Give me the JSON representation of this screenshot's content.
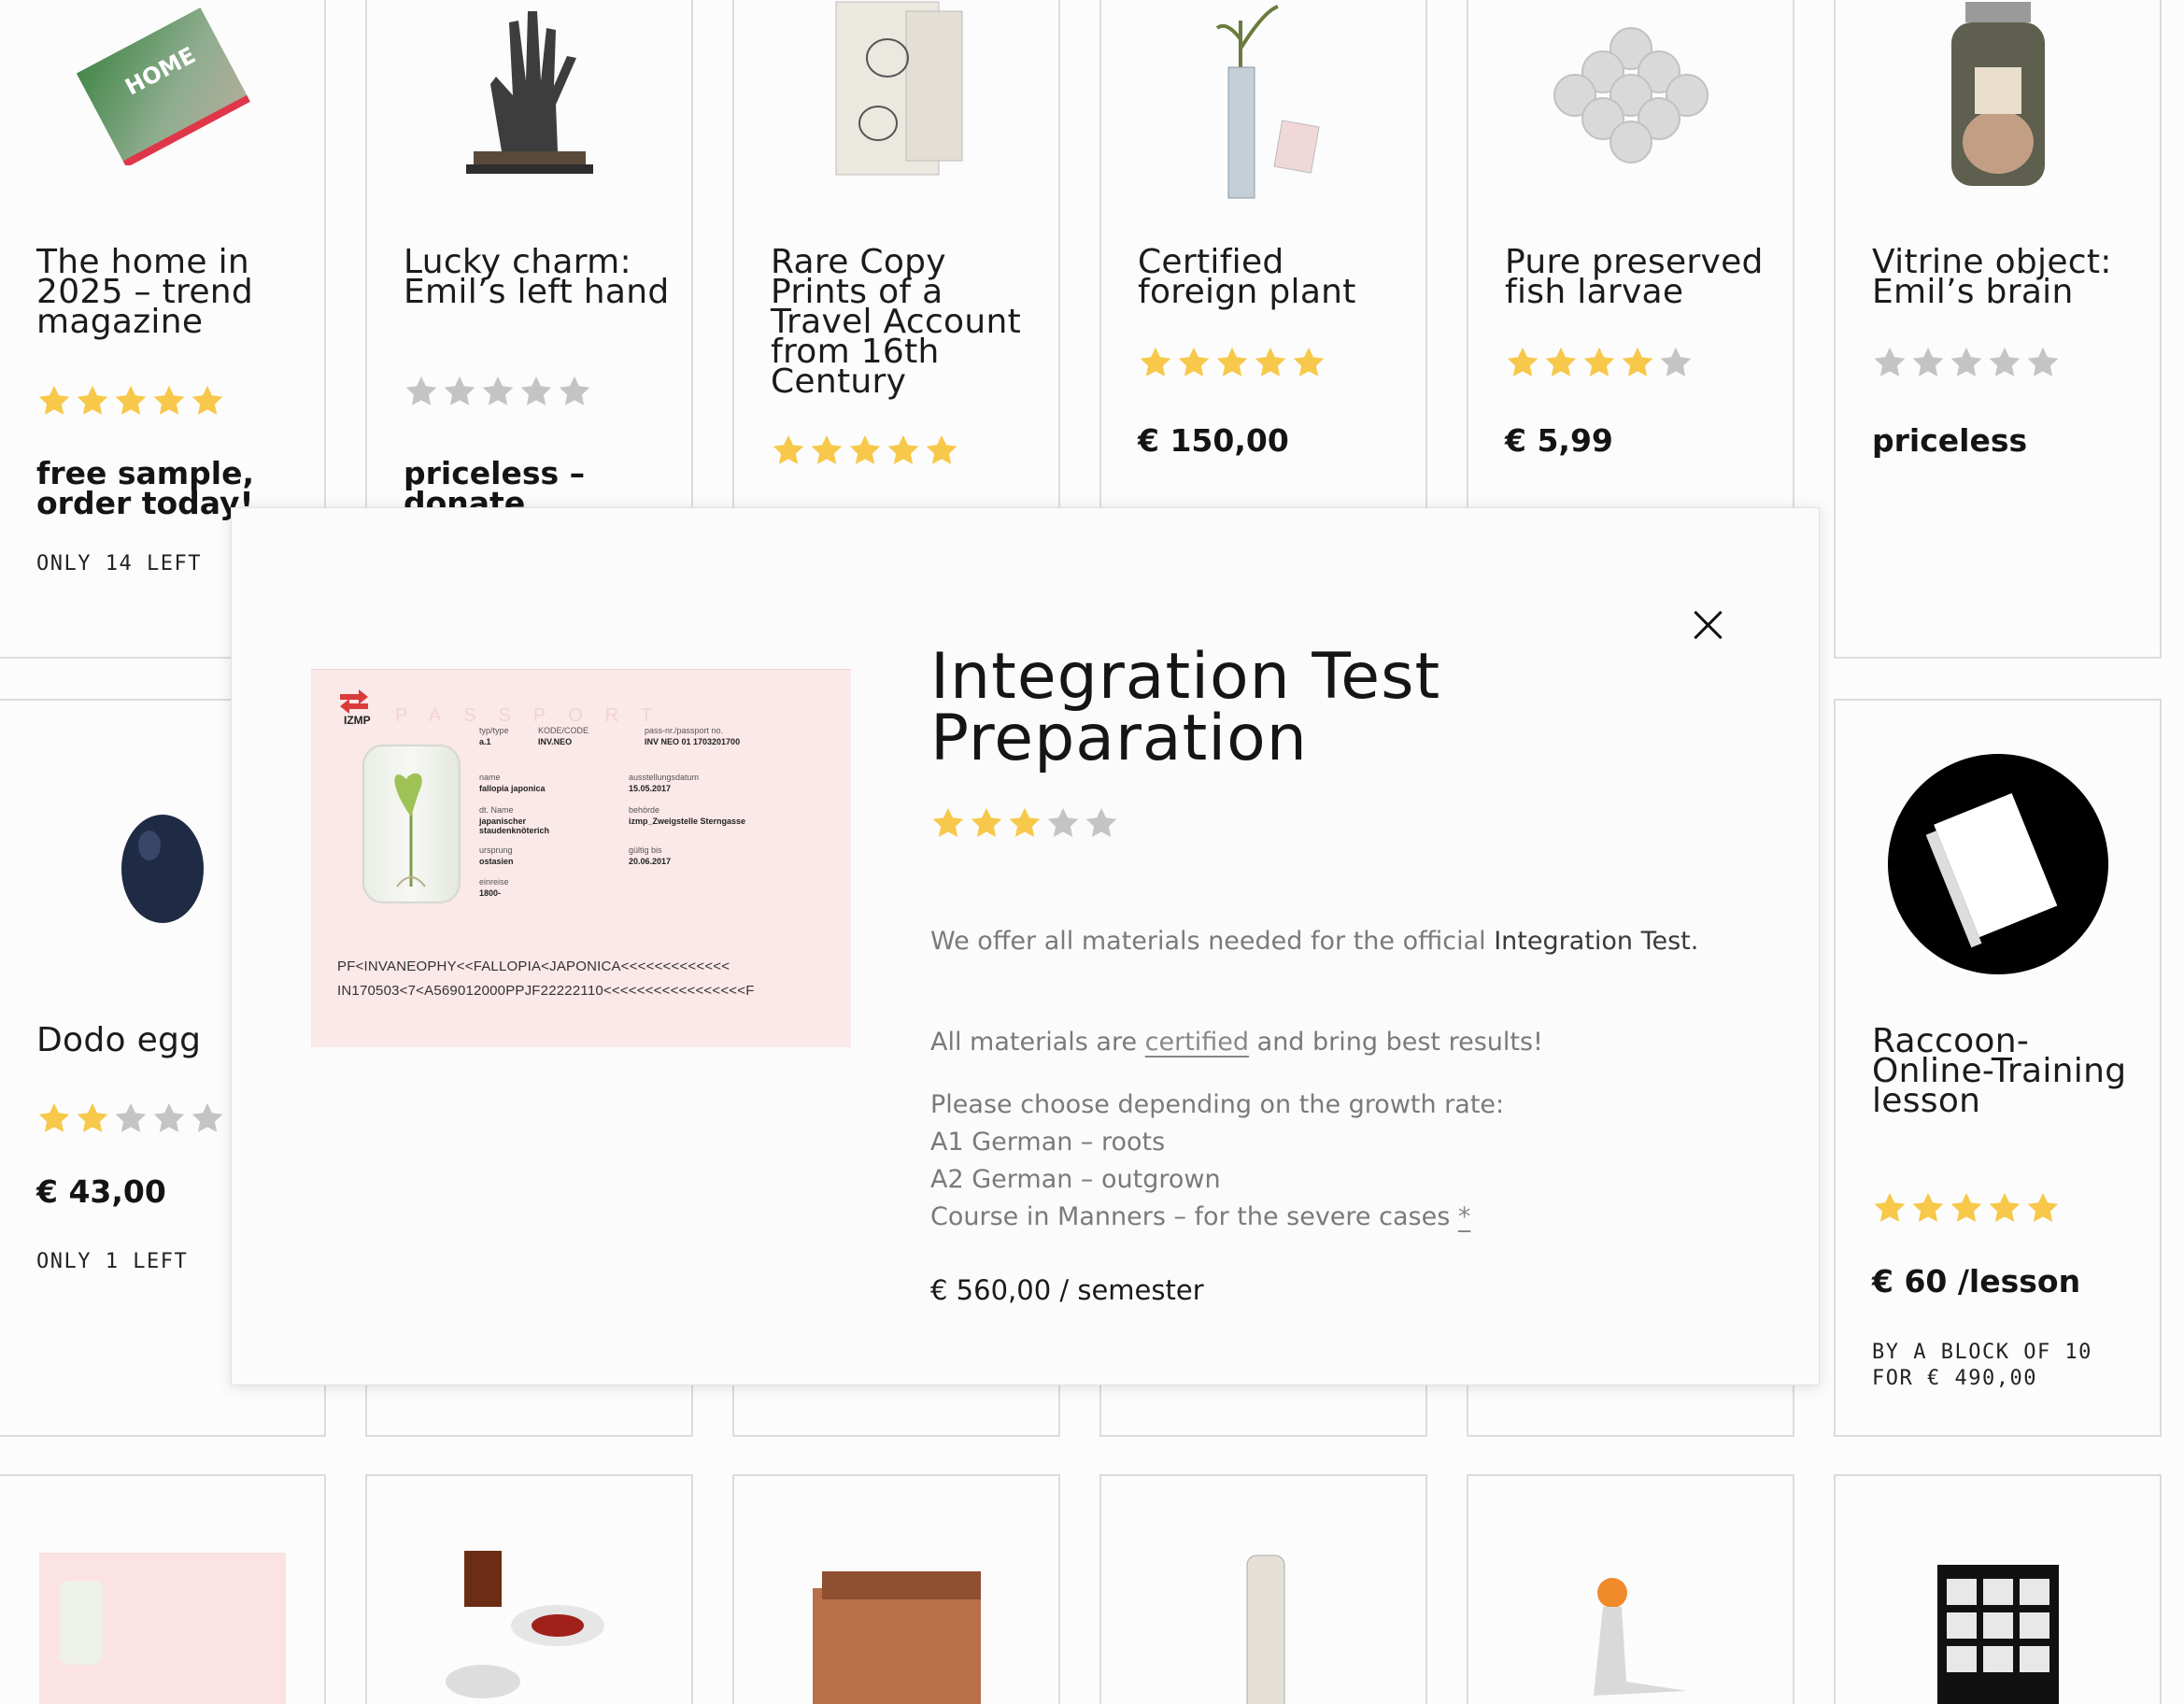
{
  "products_row1": [
    {
      "title": "The home in 2025 – trend magazine",
      "rating": 5,
      "price": "free sample, order today!",
      "stock": "ONLY 14 LEFT"
    },
    {
      "title": "Lucky charm: Emil’s left hand",
      "rating": 0,
      "price": "priceless – donate",
      "stock": ""
    },
    {
      "title": "Rare Copy Prints of a Travel Account from 16th Century",
      "rating": 5,
      "price": "",
      "stock": ""
    },
    {
      "title": "Certified foreign plant",
      "rating": 5,
      "price": "€ 150,00",
      "stock": ""
    },
    {
      "title": "Pure preserved fish larvae",
      "rating": 4,
      "price": "€ 5,99",
      "stock": ""
    },
    {
      "title": "Vitrine object: Emil’s brain",
      "rating": 0,
      "price": "priceless",
      "stock": ""
    }
  ],
  "products_row2": [
    {
      "title": "Dodo egg",
      "rating": 2,
      "price": "€ 43,00",
      "stock": "ONLY 1 LEFT"
    },
    {
      "title": "Raccoon-Online-Training lesson",
      "rating": 5,
      "price": "€ 60 /lesson",
      "stock": "BY A BLOCK OF 10 FOR € 490,00"
    }
  ],
  "modal": {
    "title": "Integration Test Preparation",
    "rating": 3,
    "para1_pre": "We offer all materials needed for the official ",
    "para1_bold": "Integration Test.",
    "para2_pre": "All materials are ",
    "para2_link": "certified",
    "para2_post": " and bring best results!",
    "choose": "Please choose depending on the growth rate:",
    "option1": "A1 German – roots",
    "option2": "A2 German – outgrown",
    "option3": "Course in Manners – for the severe cases ",
    "option3_link": "*",
    "price": "€ 560,00 / semester",
    "passport": {
      "watermark": "PASSPORT",
      "logo": "IZMP",
      "labels": [
        "typ/type",
        "KODE/CODE",
        "pass-nr./passport no.",
        "name",
        "ausstellungsdatum",
        "dt. Name",
        "behörde",
        "ursprung",
        "gültig bis",
        "einreise"
      ],
      "values": [
        "a.1",
        "INV.NEO",
        "INV NEO 01 1703201700",
        "fallopia japonica",
        "15.05.2017",
        "japanischer staudenknöterich",
        "izmp_Zweigstelle Sterngasse",
        "ostasien",
        "20.06.2017",
        "1800-"
      ],
      "mrz1": "PF<INVANEOPHY<<FALLOPIA<JAPONICA<<<<<<<<<<<<<",
      "mrz2": "IN170503<7<A569012000PPJF22222110<<<<<<<<<<<<<<<<<F"
    }
  },
  "colors": {
    "star_on": "#f7c84a",
    "star_off": "#c4c4c4",
    "border": "#dcdcdc"
  }
}
